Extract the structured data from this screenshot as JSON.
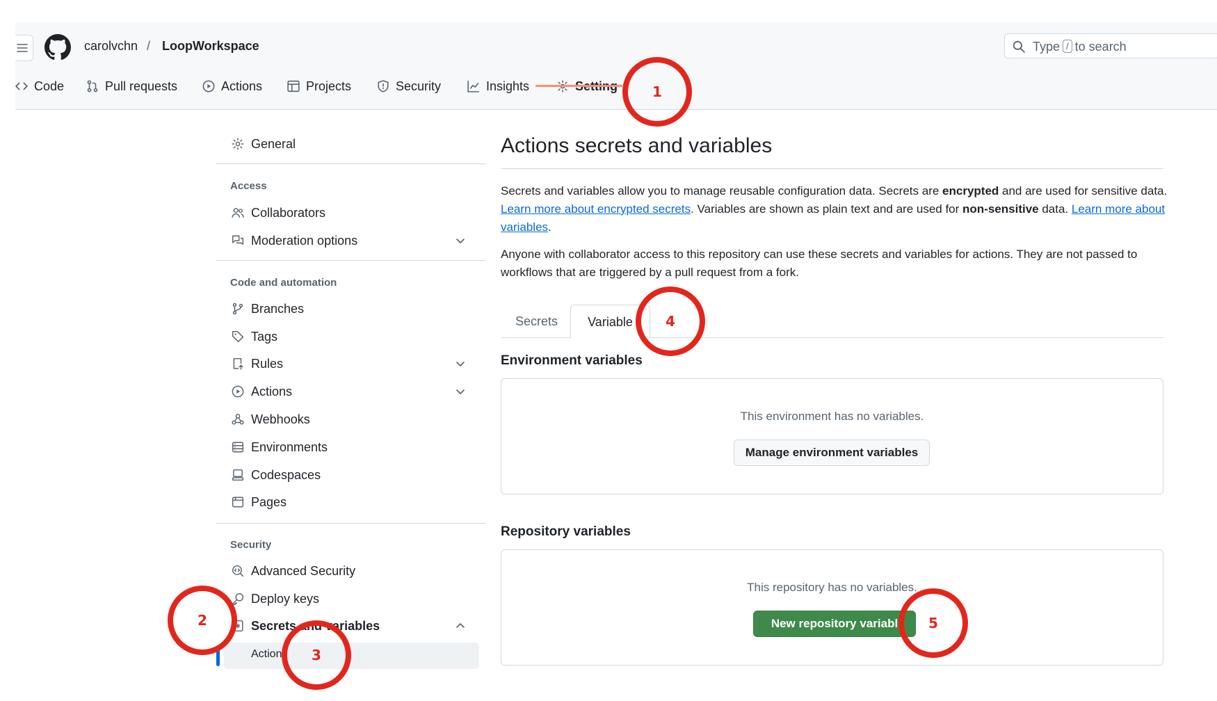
{
  "header": {
    "owner": "carolvchn",
    "separator": "/",
    "repo": "LoopWorkspace",
    "search_prefix": "Type",
    "search_key": "/",
    "search_suffix": "to search"
  },
  "repo_tabs": [
    {
      "label": "Code",
      "icon": "code-icon"
    },
    {
      "label": "Pull requests",
      "icon": "pull-request-icon"
    },
    {
      "label": "Actions",
      "icon": "play-icon"
    },
    {
      "label": "Projects",
      "icon": "table-icon"
    },
    {
      "label": "Security",
      "icon": "shield-icon"
    },
    {
      "label": "Insights",
      "icon": "graph-icon"
    },
    {
      "label": "Setting",
      "icon": "gear-icon",
      "active": true
    }
  ],
  "sidebar": {
    "general": "General",
    "access_heading": "Access",
    "access_items": [
      "Collaborators",
      "Moderation options"
    ],
    "code_heading": "Code and automation",
    "code_items": [
      "Branches",
      "Tags",
      "Rules",
      "Actions",
      "Webhooks",
      "Environments",
      "Codespaces",
      "Pages"
    ],
    "security_heading": "Security",
    "security_items": [
      "Advanced Security",
      "Deploy keys",
      "Secrets and variables"
    ],
    "secrets_sub": "Actions"
  },
  "main": {
    "title": "Actions secrets and variables",
    "p1_a": "Secrets and variables allow you to manage reusable configuration data. Secrets are ",
    "p1_b": "encrypted",
    "p1_c": " and are used for sensitive data. ",
    "p1_link1": "Learn more about encrypted secrets",
    "p1_d": ". Variables are shown as plain text and are used for ",
    "p1_e": "non-sensitive",
    "p1_f": " data. ",
    "p1_link2": "Learn more about variables",
    "p1_g": ".",
    "p2": "Anyone with collaborator access to this repository can use these secrets and variables for actions. They are not passed to workflows that are triggered by a pull request from a fork.",
    "tabs": [
      "Secrets",
      "Variable"
    ],
    "env_title": "Environment variables",
    "env_msg": "This environment has no variables.",
    "env_button": "Manage environment variables",
    "repo_title": "Repository variables",
    "repo_msg": "This repository has no variables.",
    "repo_button": "New repository variabl"
  },
  "annotations": [
    "1",
    "2",
    "3",
    "4",
    "5"
  ],
  "colors": {
    "annotation": "#e3261c",
    "primary_button": "#3e8a4a",
    "link": "#0969da",
    "tab_underline": "#fd8c73"
  }
}
